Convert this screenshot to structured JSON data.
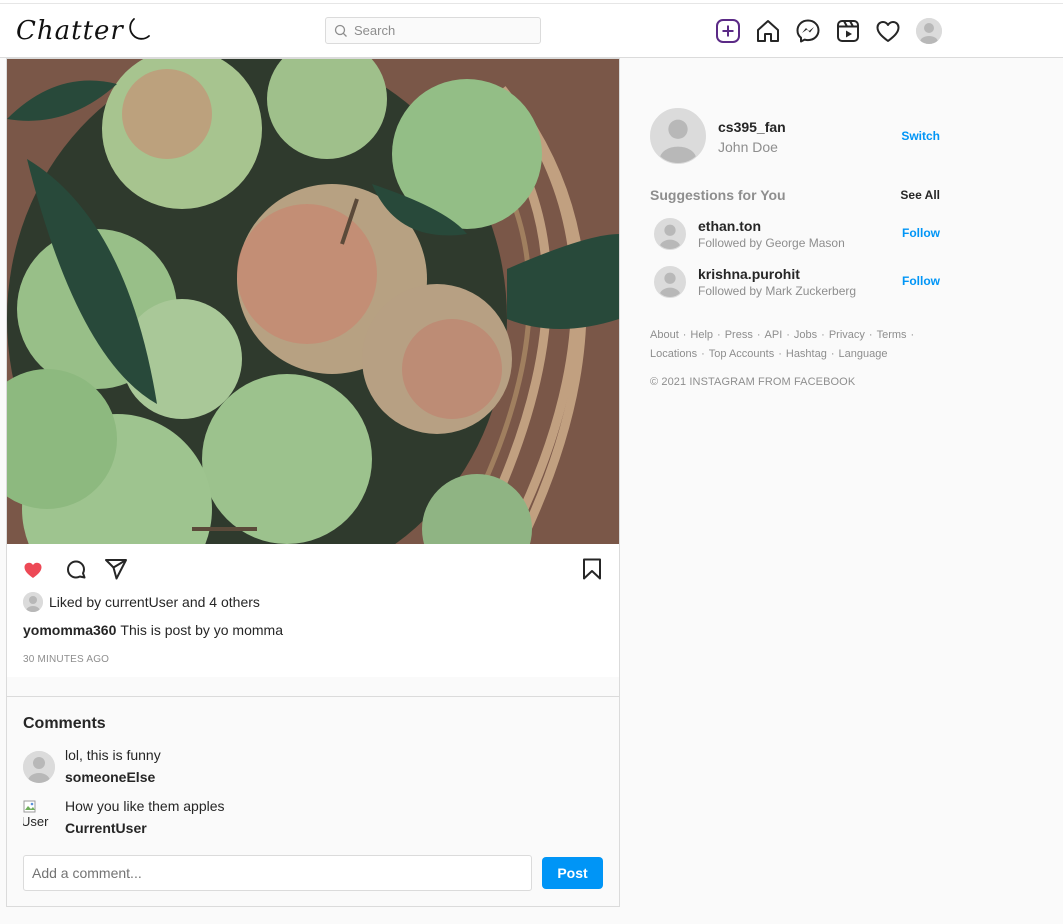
{
  "header": {
    "logo": "Chatter",
    "search_placeholder": "Search",
    "accent_color": "#5b2a86"
  },
  "post": {
    "liked_by": "Liked by currentUser and 4 others",
    "author": "yomomma360",
    "caption": "This is post by yo momma",
    "time_ago": "30 MINUTES AGO",
    "liked": true,
    "like_color": "#ed4956"
  },
  "comments": {
    "title": "Comments",
    "items": [
      {
        "text": "lol, this is funny",
        "user": "someoneElse",
        "avatar": "default"
      },
      {
        "text": "How you like them apples",
        "user": "CurrentUser",
        "avatar": "broken-image",
        "alt": "User"
      }
    ],
    "input_placeholder": "Add a comment...",
    "post_label": "Post"
  },
  "sidebar": {
    "username": "cs395_fan",
    "full_name": "John Doe",
    "switch_label": "Switch",
    "suggestions_title": "Suggestions for You",
    "see_all_label": "See All",
    "suggestions": [
      {
        "username": "ethan.ton",
        "followed_by": "Followed by George Mason",
        "action": "Follow"
      },
      {
        "username": "krishna.purohit",
        "followed_by": "Followed by Mark Zuckerberg",
        "action": "Follow"
      }
    ],
    "footer_links_row1": [
      "About",
      "Help",
      "Press",
      "API",
      "Jobs",
      "Privacy",
      "Terms"
    ],
    "footer_links_row2": [
      "Locations",
      "Top Accounts",
      "Hashtag",
      "Language"
    ],
    "copyright": "© 2021 INSTAGRAM FROM FACEBOOK"
  },
  "icons": {
    "nav": [
      "add-post-icon",
      "home-icon",
      "messenger-icon",
      "reels-icon",
      "heart-icon",
      "profile-avatar"
    ],
    "post_actions": [
      "like-icon",
      "comment-icon",
      "share-icon",
      "bookmark-icon"
    ]
  }
}
